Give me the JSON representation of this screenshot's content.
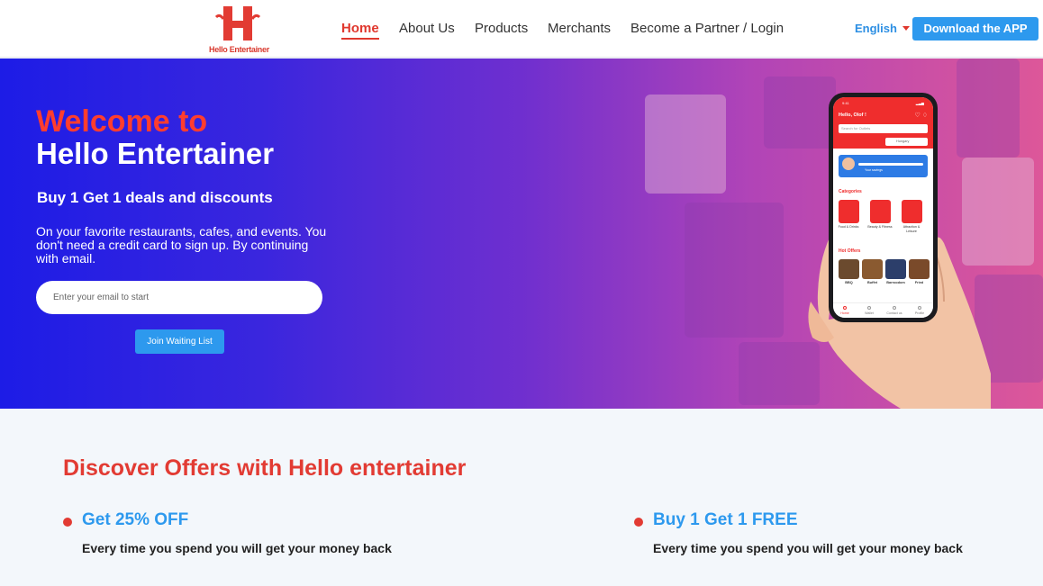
{
  "brand": {
    "logo_text": "Hello Entertainer",
    "accent_red": "#e0382e",
    "accent_blue": "#2d99ee"
  },
  "nav": {
    "items": [
      "Home",
      "About Us",
      "Products",
      "Merchants",
      "Become a Partner / Login"
    ],
    "active": "Home"
  },
  "header": {
    "language": "English",
    "download_button": "Download the APP"
  },
  "hero": {
    "title_line1": "Welcome to",
    "title_line2": "Hello Entertainer",
    "subtitle": "Buy 1 Get 1 deals and discounts",
    "description": "On your favorite restaurants, cafes, and events. You don't need a credit card to sign up. By continuing with email.",
    "email_placeholder": "Enter your email to start",
    "join_button": "Join Waiting List"
  },
  "phone_app": {
    "greeting": "Hello, Olof !",
    "search_placeholder": "Search for Outlets",
    "country": "Hungary",
    "savings_label": "Your savings",
    "categories_title": "Categories",
    "categories": [
      "Food & Drinks",
      "Beauty & Fitness",
      "Attraction & Leisure"
    ],
    "hot_offers_title": "Hot Offers",
    "hot_offers": [
      "BBQ",
      "Buffet",
      "Barroodom",
      "Fried"
    ],
    "tabs": [
      "Home",
      "Wallet",
      "Contact us",
      "Profile"
    ]
  },
  "offers": {
    "title": "Discover Offers with Hello entertainer",
    "items": [
      {
        "title": "Get 25% OFF",
        "desc": "Every time you spend you will get your money back"
      },
      {
        "title": "Buy 1 Get 1 FREE",
        "desc": "Every time you spend you will get your money back"
      }
    ]
  }
}
